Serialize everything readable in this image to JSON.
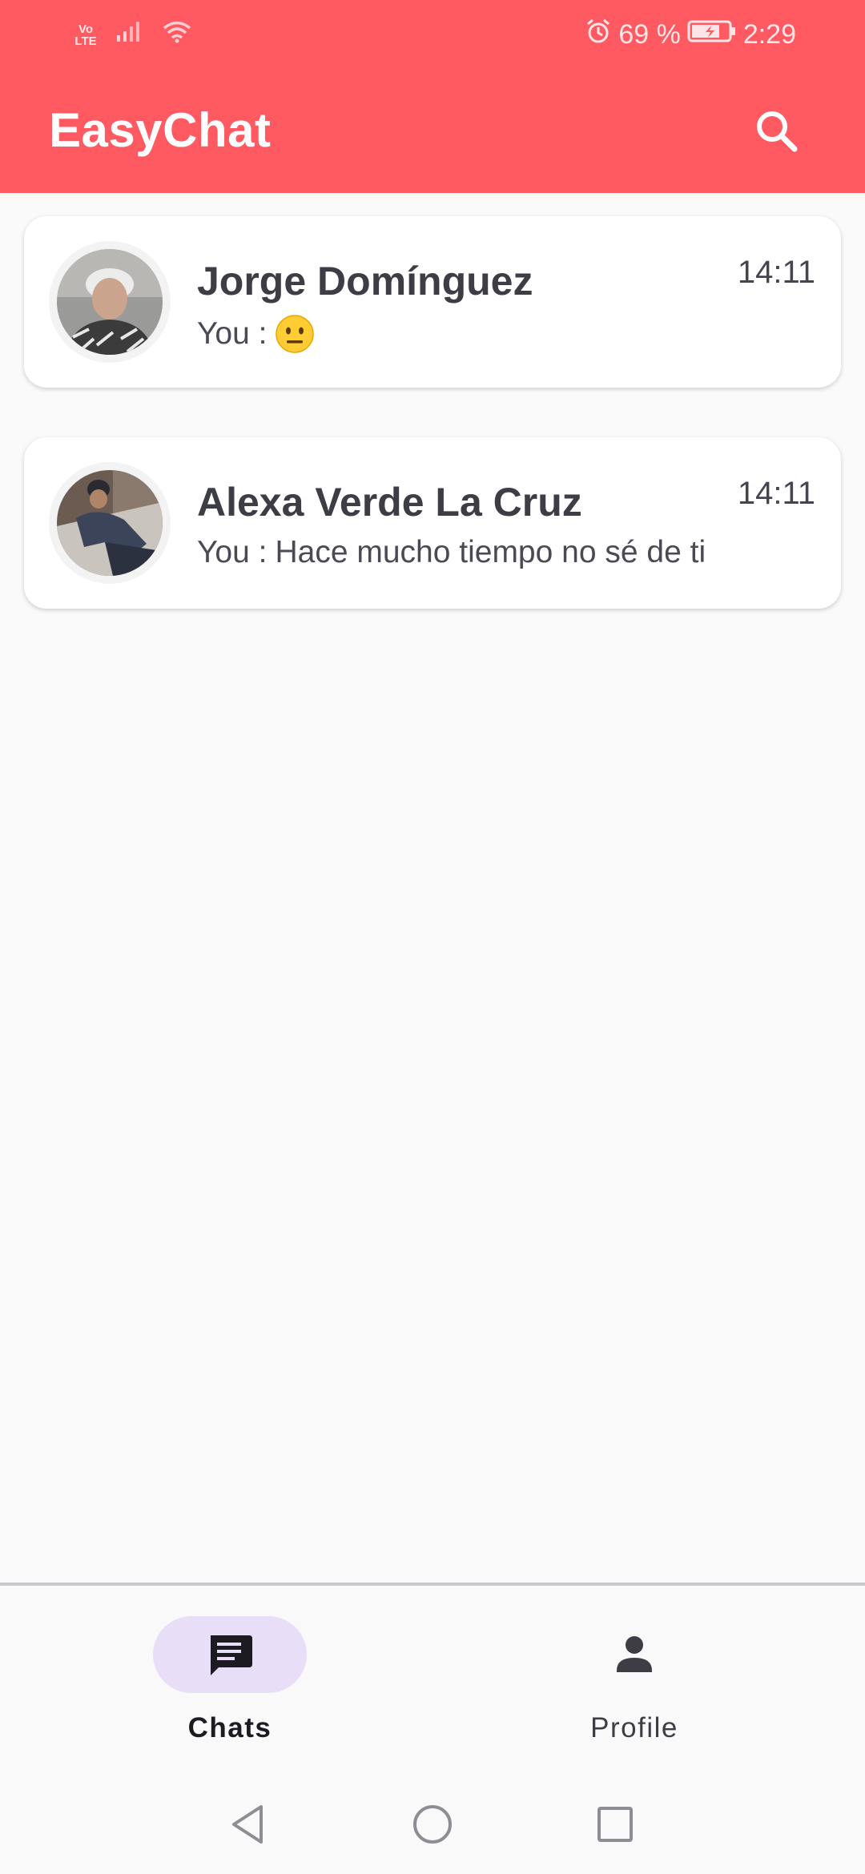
{
  "status_bar": {
    "network_label": "Vo\nLTE",
    "battery_percent": "69 %",
    "time": "2:29"
  },
  "app_bar": {
    "title": "EasyChat",
    "search_icon": "search-icon"
  },
  "chats": [
    {
      "name": "Jorge Domínguez",
      "last_message_prefix": "You :",
      "last_message_text": "",
      "last_message_emoji": "neutral-face-emoji",
      "time": "14:11",
      "avatar_icon": "avatar-photo"
    },
    {
      "name": "Alexa Verde La Cruz",
      "last_message_prefix": "You :",
      "last_message_text": "Hace mucho tiempo no sé de ti",
      "time": "14:11",
      "avatar_icon": "avatar-photo"
    }
  ],
  "bottom_nav": {
    "items": [
      {
        "label": "Chats",
        "icon": "chat-icon",
        "active": true
      },
      {
        "label": "Profile",
        "icon": "person-icon",
        "active": false
      }
    ]
  },
  "system_nav": {
    "back_icon": "back-triangle-icon",
    "home_icon": "home-circle-icon",
    "recents_icon": "recents-square-icon"
  },
  "colors": {
    "primary": "#ff5a62",
    "nav_pill": "#e8def7",
    "background": "#fafafa"
  }
}
